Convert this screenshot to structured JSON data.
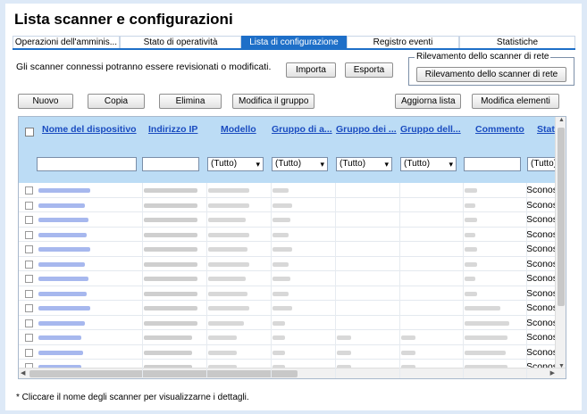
{
  "header": {
    "title": "Lista scanner e configurazioni"
  },
  "tabs": [
    {
      "label": "Operazioni dell'amminis...",
      "active": false
    },
    {
      "label": "Stato di operatività",
      "active": false
    },
    {
      "label": "Lista di configurazione",
      "active": true
    },
    {
      "label": "Registro eventi",
      "active": false
    },
    {
      "label": "Statistiche",
      "active": false
    }
  ],
  "description": "Gli scanner connessi potranno essere revisionati o modificati.",
  "actions": {
    "import": "Importa",
    "export": "Esporta"
  },
  "network_detection": {
    "legend": "Rilevamento dello scanner di rete",
    "button": "Rilevamento dello scanner di rete"
  },
  "toolbar": {
    "new": "Nuovo",
    "copy": "Copia",
    "delete": "Elimina",
    "edit_group": "Modifica il gruppo",
    "refresh": "Aggiorna lista",
    "edit_items": "Modifica elementi"
  },
  "table": {
    "columns": [
      "Nome del dispositivo",
      "Indirizzo IP",
      "Modello",
      "Gruppo di a...",
      "Gruppo dei ...",
      "Gruppo dell...",
      "Commento",
      "Stat"
    ],
    "filters": {
      "select_value": "(Tutto)"
    },
    "row_status": "Sconosc",
    "row_count": 14
  },
  "footer_note": "* Cliccare il nome degli scanner per visualizzarne i dettagli.",
  "colors": {
    "accent": "#1e6fc8",
    "header_bg": "#bcdcf5",
    "link": "#1a4cc0"
  }
}
